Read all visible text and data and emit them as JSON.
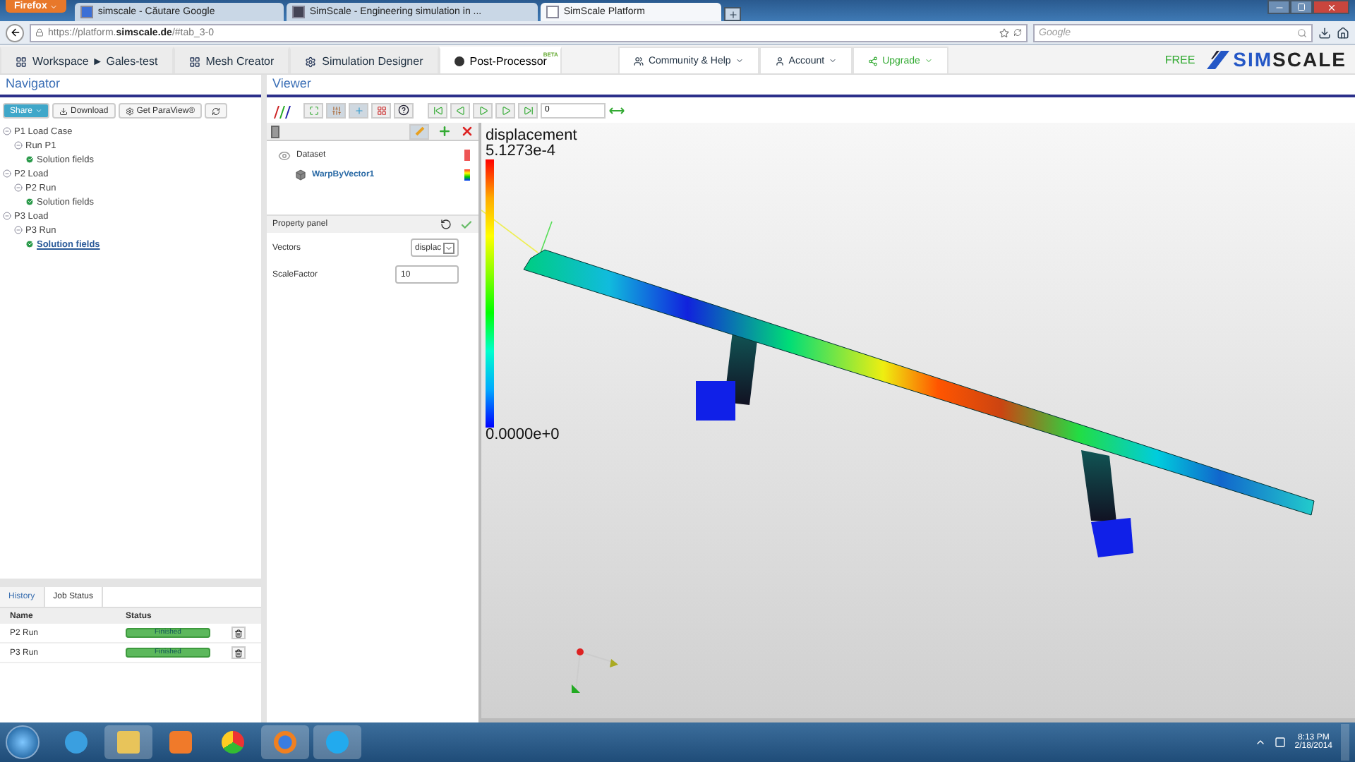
{
  "browser": {
    "menu_button": "Firefox",
    "tabs": [
      {
        "title": "simscale - Căutare Google",
        "selected": false
      },
      {
        "title": "SimScale - Engineering simulation in ...",
        "selected": false
      },
      {
        "title": "SimScale Platform",
        "selected": true
      }
    ],
    "url": "https://platform.**simscale.de**/#tab_3-0",
    "search_placeholder": "Google"
  },
  "nav": {
    "tabs": [
      {
        "label": "Workspace ► Gales-test",
        "selected": false
      },
      {
        "label": "Mesh Creator",
        "selected": false
      },
      {
        "label": "Simulation Designer",
        "selected": false
      },
      {
        "label": "Post-Processor",
        "badge": "BETA",
        "selected": true
      }
    ],
    "menus": [
      "Community & Help",
      "Account",
      "Upgrade"
    ],
    "plan": "FREE",
    "logo": "**SIM**SCALE"
  },
  "navigator": {
    "title": "Navigator",
    "buttons": [
      "Share",
      "Download",
      "Get ParaView®"
    ],
    "tree": [
      {
        "label": "P1 Load Case",
        "selected": false,
        "children": [
          {
            "label": "Run P1",
            "selected": false,
            "children": [
              {
                "label": "Solution fields",
                "selected": false
              }
            ]
          }
        ]
      },
      {
        "label": "P2 Load",
        "selected": false,
        "children": [
          {
            "label": "P2 Run",
            "selected": false,
            "children": [
              {
                "label": "Solution fields",
                "selected": false
              }
            ]
          }
        ]
      },
      {
        "label": "P3 Load",
        "selected": false,
        "children": [
          {
            "label": "P3 Run",
            "selected": false,
            "children": [
              {
                "label": "Solution fields",
                "selected": true
              }
            ]
          }
        ]
      }
    ]
  },
  "jobs": {
    "tabs": [
      {
        "label": "History",
        "selected": false
      },
      {
        "label": "Job Status",
        "selected": true
      }
    ],
    "columns": [
      "Name",
      "Status"
    ],
    "rows": [
      {
        "name": "P2 Run",
        "status": "Finished",
        "level": 1
      },
      {
        "name": "P3 Run",
        "status": "Finished",
        "level": 1
      }
    ]
  },
  "viewer": {
    "title": "Viewer",
    "frame": "0",
    "pipeline": [
      {
        "name": "Dataset",
        "selected": false
      },
      {
        "name": "WarpByVector1",
        "selected": true
      }
    ],
    "property_panel": {
      "title": "Property panel",
      "fields": [
        {
          "label": "Vectors",
          "value": "displac",
          "kind": "select"
        },
        {
          "label": "ScaleFactor",
          "value": "10",
          "kind": "text"
        }
      ]
    },
    "legend": {
      "title": "displacement",
      "max": "5.1273e-4",
      "min": "0.0000e+0"
    }
  },
  "taskbar": {
    "time": "8:13 PM",
    "date": "2/18/2014"
  }
}
